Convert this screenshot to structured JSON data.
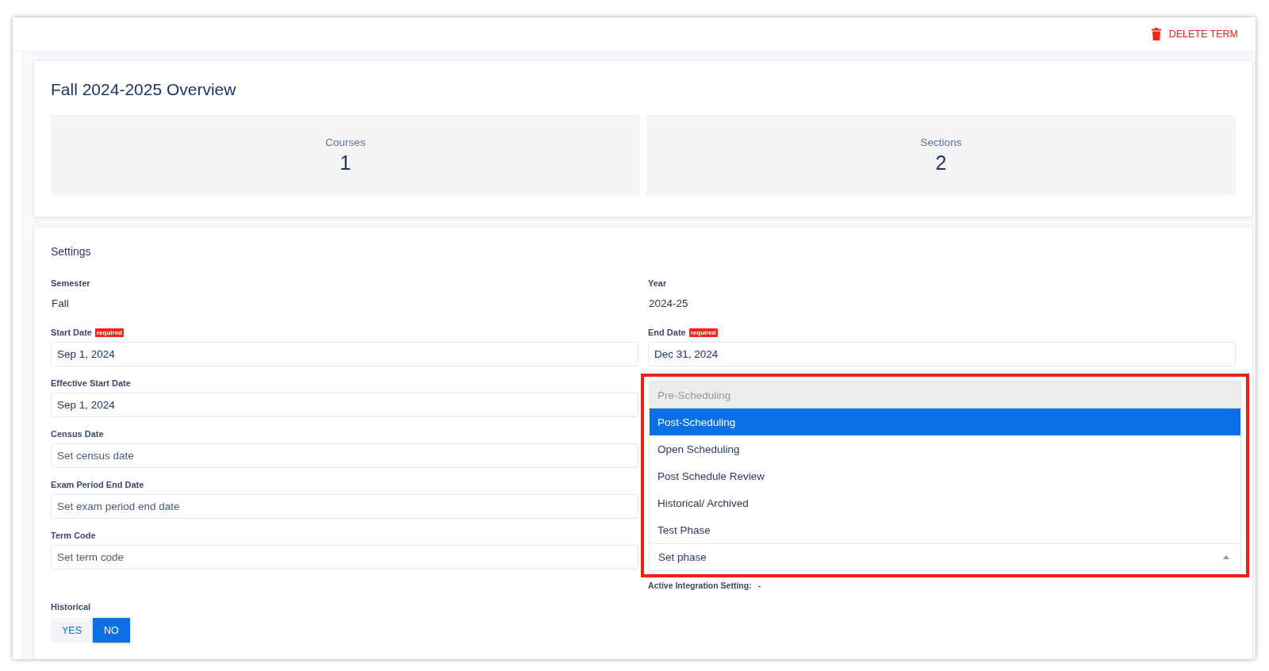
{
  "header": {
    "delete_button": "DELETE TERM"
  },
  "overview": {
    "title": "Fall 2024-2025 Overview",
    "stats": [
      {
        "label": "Courses",
        "value": "1"
      },
      {
        "label": "Sections",
        "value": "2"
      }
    ]
  },
  "settings": {
    "title": "Settings",
    "left": [
      {
        "kind": "text",
        "label": "Semester",
        "value": "Fall"
      },
      {
        "kind": "field",
        "label": "Start Date",
        "required": true,
        "badge": "required",
        "value": "Sep 1, 2024"
      },
      {
        "kind": "field",
        "label": "Effective Start Date",
        "required": false,
        "value": "Sep 1, 2024"
      },
      {
        "kind": "field",
        "label": "Census Date",
        "required": false,
        "placeholder": "Set census date"
      },
      {
        "kind": "field",
        "label": "Exam Period End Date",
        "required": false,
        "placeholder": "Set exam period end date"
      },
      {
        "kind": "field",
        "label": "Term Code",
        "required": false,
        "placeholder": "Set term code"
      }
    ],
    "right": [
      {
        "kind": "text",
        "label": "Year",
        "value": "2024-25"
      },
      {
        "kind": "field",
        "label": "End Date",
        "required": true,
        "badge": "required",
        "value": "Dec 31, 2024"
      }
    ],
    "phase_menu": {
      "expanded": true,
      "highlighted": true,
      "options": [
        {
          "label": "Pre-Scheduling",
          "disabled": true,
          "selected": false
        },
        {
          "label": "Post-Scheduling",
          "disabled": false,
          "selected": true
        },
        {
          "label": "Open Scheduling",
          "disabled": false,
          "selected": false
        },
        {
          "label": "Post Schedule Review",
          "disabled": false,
          "selected": false
        },
        {
          "label": "Historical/ Archived",
          "disabled": false,
          "selected": false
        },
        {
          "label": "Test Phase",
          "disabled": false,
          "selected": false
        }
      ],
      "placeholder": "Set phase"
    },
    "integration": {
      "label": "Active Integration Setting:",
      "value": "-"
    },
    "historical": {
      "label": "Historical",
      "options": [
        {
          "label": "YES",
          "selected": false
        },
        {
          "label": "NO",
          "selected": true
        }
      ]
    }
  }
}
